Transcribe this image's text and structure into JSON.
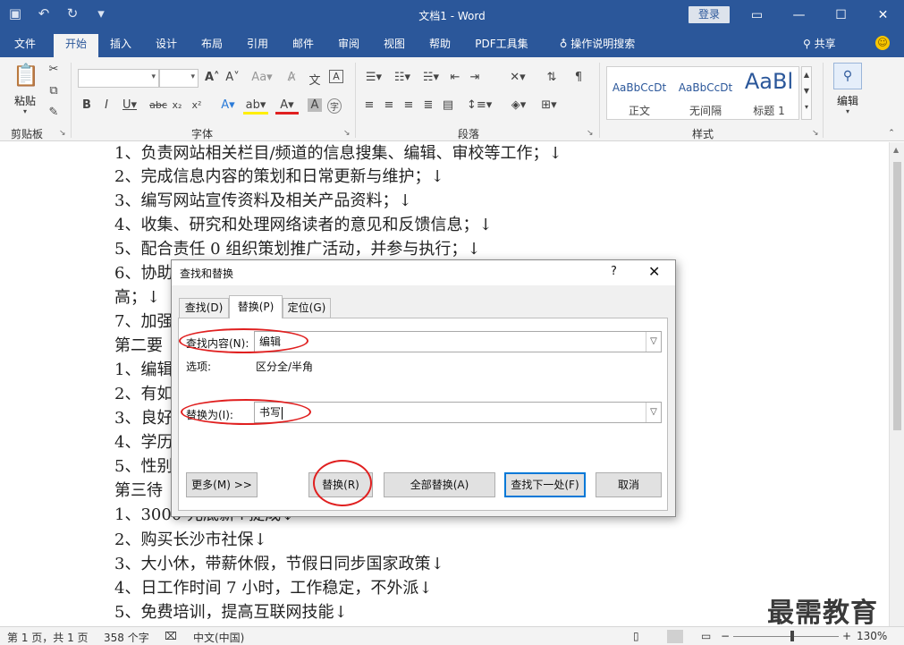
{
  "app": {
    "window_title": "文档1  -  Word",
    "login_label": "登录"
  },
  "ribbon_tabs": [
    {
      "label": "文件"
    },
    {
      "label": "开始"
    },
    {
      "label": "插入"
    },
    {
      "label": "设计"
    },
    {
      "label": "布局"
    },
    {
      "label": "引用"
    },
    {
      "label": "邮件"
    },
    {
      "label": "审阅"
    },
    {
      "label": "视图"
    },
    {
      "label": "帮助"
    },
    {
      "label": "PDF工具集"
    },
    {
      "label": "操作说明搜索"
    }
  ],
  "active_tab": "开始",
  "share_label": "共享",
  "ribbon": {
    "clipboard": {
      "paste_label": "粘贴",
      "group_label": "剪贴板"
    },
    "font": {
      "group_label": "字体"
    },
    "paragraph": {
      "group_label": "段落"
    },
    "styles": {
      "group_label": "样式",
      "items": [
        {
          "sample": "AaBbCcDt",
          "name": "正文"
        },
        {
          "sample": "AaBbCcDt",
          "name": "无间隔"
        },
        {
          "sample": "AaBl",
          "name": "标题 1"
        }
      ]
    },
    "editing": {
      "label": "编辑"
    }
  },
  "document": {
    "lines": [
      "1、负责网站相关栏目/频道的信息搜集、编辑、审校等工作；↓",
      "2、完成信息内容的策划和日常更新与维护；↓",
      "3、编写网站宣传资料及相关产品资料；↓",
      "4、收集、研究和处理网络读者的意见和反馈信息；↓",
      "5、配合责任 0 组织策划推广活动，并参与执行；↓",
      "6、协助",
      "高；↓",
      "7、加强",
      "第二要",
      "1、编辑",
      "2、有如",
      "3、良好",
      "4、学历",
      "5、性别",
      "第三待",
      "1、3000 元底薪+提成↓",
      "2、购买长沙市社保↓",
      "3、大小休，带薪休假，节假日同步国家政策↓",
      "4、日工作时间 7 小时，工作稳定，不外派↓",
      "5、免费培训，提高互联网技能↓"
    ]
  },
  "dialog": {
    "title": "查找和替换",
    "help": "?",
    "close": "✕",
    "tabs": [
      {
        "label": "查找(D)"
      },
      {
        "label": "替换(P)"
      },
      {
        "label": "定位(G)"
      }
    ],
    "find_label": "查找内容(N):",
    "find_value": "编辑",
    "options_label": "选项:",
    "options_value": "区分全/半角",
    "replace_label": "替换为(I):",
    "replace_value": "书写",
    "buttons": {
      "more": "更多(M) >>",
      "replace": "替换(R)",
      "replace_all": "全部替换(A)",
      "find_next": "查找下一处(F)",
      "cancel": "取消"
    }
  },
  "status_bar": {
    "page": "第 1 页，共 1 页",
    "words": "358 个字",
    "language": "中文(中国)",
    "zoom": "130%"
  },
  "watermark": "最需教育",
  "colors": {
    "word_blue": "#2b579a",
    "annotation_red": "#e02020",
    "default_button_border": "#0078d7"
  }
}
